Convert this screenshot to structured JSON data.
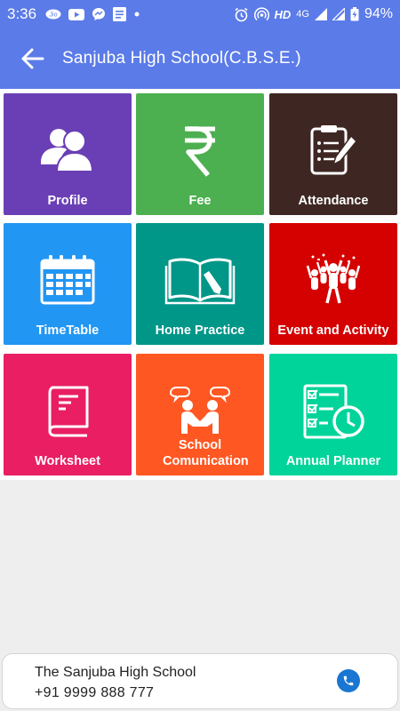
{
  "status_bar": {
    "time": "3:36",
    "network": "HD",
    "signal": "4G",
    "battery": "94%"
  },
  "app_bar": {
    "title": "Sanjuba High School(C.B.S.E.)"
  },
  "colors": {
    "header": "#5b7be8",
    "profile": "#6a3fb5",
    "fee": "#4caf50",
    "attendance": "#3e2723",
    "timetable": "#2196f3",
    "home_practice": "#009688",
    "event": "#d50000",
    "worksheet": "#e91e63",
    "communication": "#ff5722",
    "planner": "#00d49a"
  },
  "tiles": [
    {
      "label": "Profile",
      "icon": "users-icon"
    },
    {
      "label": "Fee",
      "icon": "rupee-icon"
    },
    {
      "label": "Attendance",
      "icon": "clipboard-icon"
    },
    {
      "label": "TimeTable",
      "icon": "calendar-icon"
    },
    {
      "label": "Home Practice",
      "icon": "open-book-icon"
    },
    {
      "label": "Event and Activity",
      "icon": "celebration-icon"
    },
    {
      "label": "Worksheet",
      "icon": "notebook-icon"
    },
    {
      "label": "School Comunication",
      "icon": "handshake-icon"
    },
    {
      "label": "Annual Planner",
      "icon": "planner-icon"
    }
  ],
  "footer": {
    "school_name": "The Sanjuba High School",
    "phone": "+91 9999 888 777",
    "call_icon": "phone-icon"
  }
}
